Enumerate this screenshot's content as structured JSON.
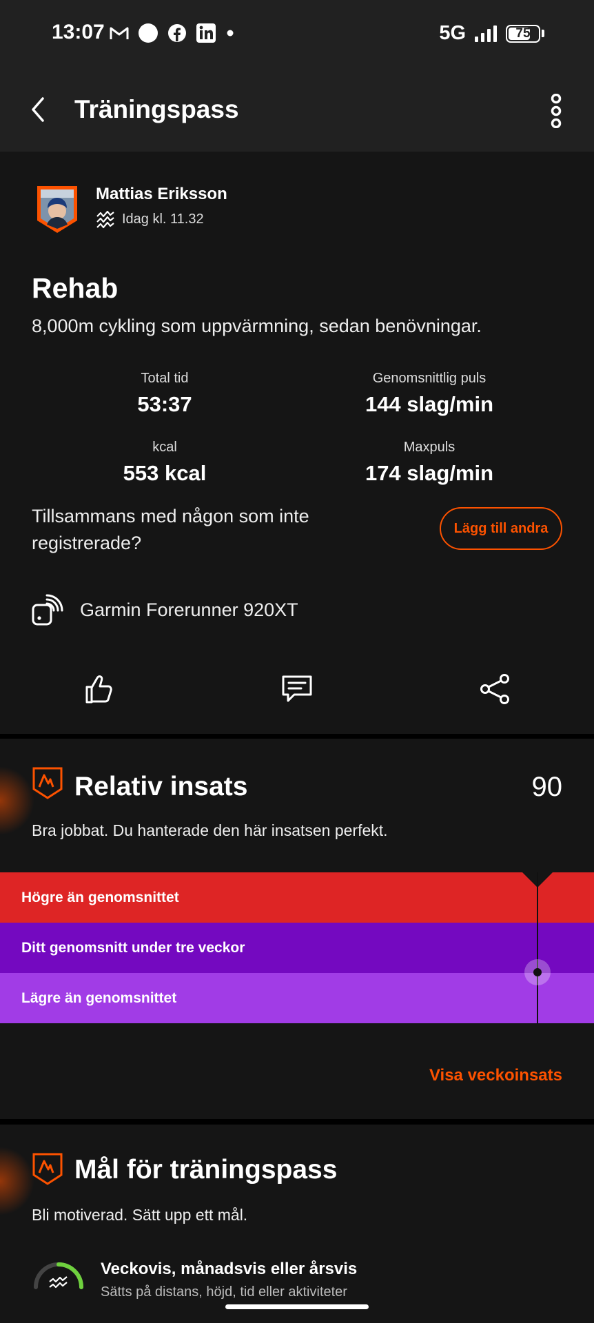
{
  "status_bar": {
    "time": "13:07",
    "network": "5G",
    "battery": "75",
    "battery_level": 0.75,
    "icons": [
      "gmail-icon",
      "circle-notification-icon",
      "facebook-icon",
      "linkedin-icon",
      "dot-icon",
      "signal-icon",
      "battery-icon"
    ]
  },
  "app_bar": {
    "title": "Träningspass",
    "icons": [
      "back-arrow-icon",
      "more-vertical-icon"
    ]
  },
  "activity": {
    "athlete_name": "Mattias Eriksson",
    "time": "Idag kl. 11.32",
    "title": "Rehab",
    "description": "8,000m cykling som uppvärmning, sedan benövningar.",
    "stats": [
      {
        "label": "Total tid",
        "value": "53:37"
      },
      {
        "label": "Genomsnittlig puls",
        "value": "144 slag/min"
      },
      {
        "label": "kcal",
        "value": "553 kcal"
      },
      {
        "label": "Maxpuls",
        "value": "174 slag/min"
      }
    ],
    "together_text": "Tillsammans med någon som inte registrerade?",
    "add_others_label": "Lägg till andra",
    "device": "Garmin Forerunner 920XT",
    "actions": [
      "kudos-thumb-icon",
      "comment-icon",
      "share-icon"
    ]
  },
  "relative_effort": {
    "title": "Relativ insats",
    "score": "90",
    "subtitle": "Bra jobbat. Du hanterade den här insatsen perfekt.",
    "bands": [
      {
        "label": "Högre än genomsnittet",
        "color": "#de2525"
      },
      {
        "label": "Ditt genomsnitt under tre veckor",
        "color": "#7409c0"
      },
      {
        "label": "Lägre än genomsnittet",
        "color": "#a13ce6"
      }
    ],
    "link": "Visa veckoinsats"
  },
  "goals": {
    "title": "Mål för träningspass",
    "subtitle": "Bli motiverad. Sätt upp ett mål.",
    "item_title": "Veckovis, månadsvis eller årsvis",
    "item_subtitle": "Sätts på distans, höjd, tid eller aktiviteter"
  },
  "colors": {
    "accent": "#fc5200",
    "card_bg": "#151515",
    "bar_bg": "#212121"
  }
}
